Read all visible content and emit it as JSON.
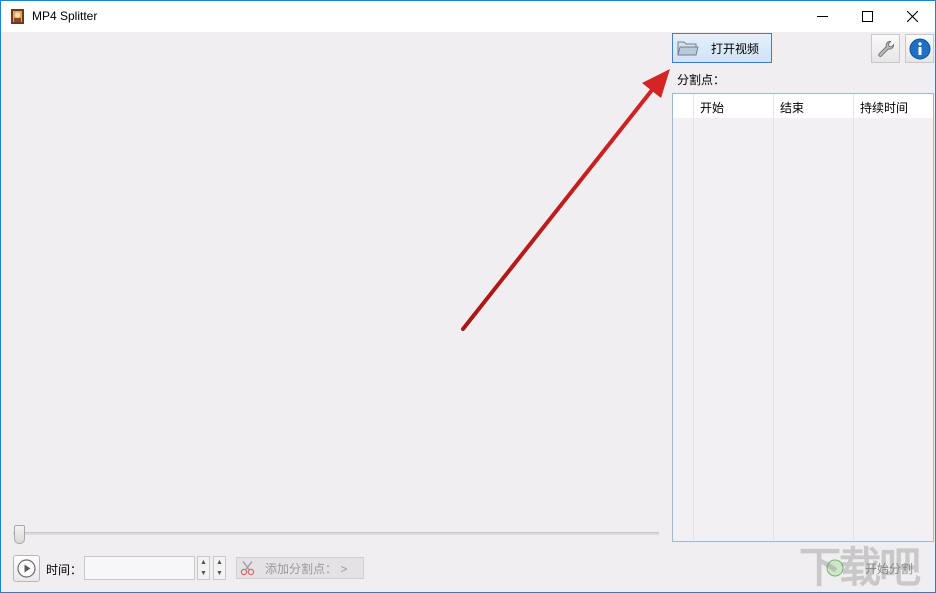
{
  "window": {
    "title": "MP4 Splitter",
    "controls": {
      "minimize": "minimize-icon",
      "maximize": "maximize-icon",
      "close": "close-icon"
    }
  },
  "toolbar": {
    "open_video_label": "打开视频",
    "settings_icon": "wrench-icon",
    "info_icon": "info-icon"
  },
  "split_points": {
    "label": "分割点：",
    "columns": [
      "",
      "开始",
      "结束",
      "持续时间"
    ],
    "rows": []
  },
  "controls": {
    "time_label": "时间：",
    "time_value": "",
    "add_split_label": "添加分割点： >",
    "start_split_label": "开始分割"
  },
  "watermark": {
    "text": "下载吧"
  },
  "colors": {
    "accent_border": "#1883d7",
    "arrow": "#cc1f1f",
    "background": "#f0eef0"
  }
}
